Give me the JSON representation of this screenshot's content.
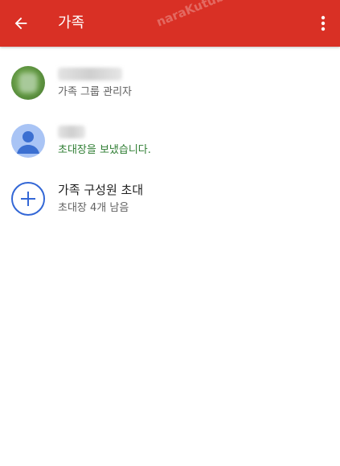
{
  "appbar": {
    "title": "가족",
    "background": "#d93025",
    "back_icon": "arrow-back-icon",
    "more_icon": "more-vert-icon"
  },
  "watermark": {
    "text": "naraKutube"
  },
  "members": [
    {
      "name": "",
      "role": "가족 그룹 관리자",
      "avatar": "photo-avatar"
    },
    {
      "name": "",
      "status": "초대장을 보냈습니다.",
      "avatar": "default-person-avatar"
    }
  ],
  "invite": {
    "label": "가족 구성원 초대",
    "sub_label": "초대장 4개 남음",
    "icon": "add-icon",
    "accent": "#3367d6"
  }
}
